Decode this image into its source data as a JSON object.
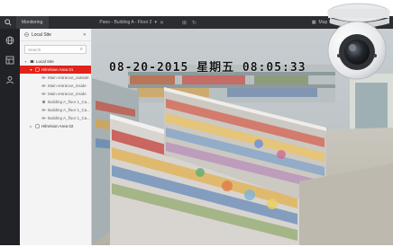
{
  "titlebar": {
    "app_icon": "search-icon",
    "tab_monitoring": "Monitoring",
    "view_name": "Pano - Building A - Floor 2",
    "right_view": "Map V"
  },
  "rail": {
    "icons": [
      "globe-icon",
      "layout-icon",
      "user-icon"
    ]
  },
  "resource_panel": {
    "site_label": "Local Site",
    "search_placeholder": "Search",
    "tree": {
      "root": "Local Site",
      "area_selected": "HikVision Area 01",
      "cameras": [
        "Main entrance_outside",
        "Main entrance_inside",
        "Main entrance_inside",
        "Building A_floor 1_Ca...",
        "Building A_floor 1_Ca...",
        "Building A_floor 1_Ca..."
      ],
      "area_other": "HikVision Area 02"
    }
  },
  "video": {
    "osd_timestamp": "08-20-2015 星期五 08:05:33"
  },
  "colors": {
    "selected": "#e2231a",
    "titlebar": "#2b2d31",
    "rail": "#202226",
    "panel": "#f4f4f4"
  }
}
